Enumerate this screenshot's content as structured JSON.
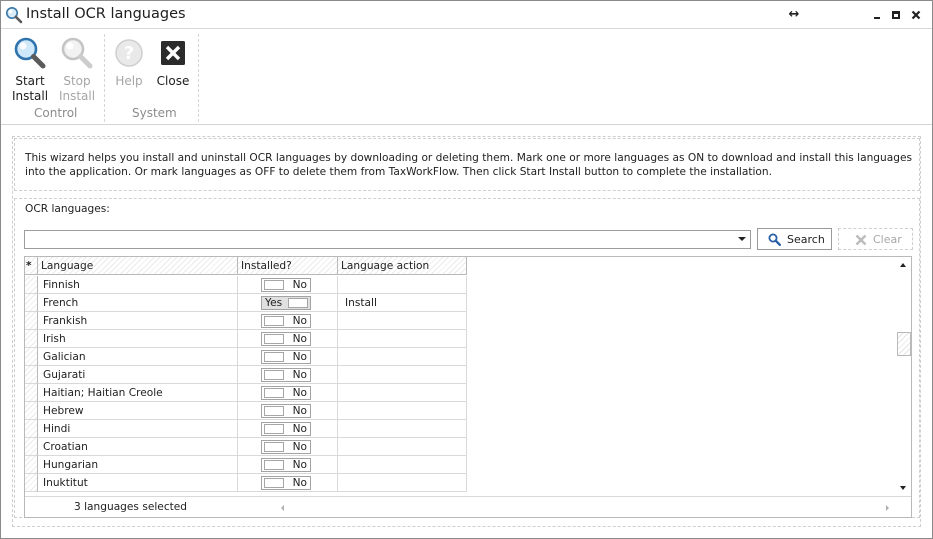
{
  "window": {
    "title": "Install OCR languages"
  },
  "ribbon": {
    "groups": [
      {
        "label": "Control",
        "buttons": [
          {
            "line1": "Start",
            "line2": "Install",
            "icon": "magnifier-icon",
            "enabled": true
          },
          {
            "line1": "Stop",
            "line2": "Install",
            "icon": "magnifier-gray-icon",
            "enabled": false
          }
        ]
      },
      {
        "label": "System",
        "buttons": [
          {
            "line1": "Help",
            "line2": "",
            "icon": "help-icon",
            "enabled": false
          },
          {
            "line1": "Close",
            "line2": "",
            "icon": "close-icon",
            "enabled": true
          }
        ]
      }
    ]
  },
  "description": "This wizard helps you install and uninstall OCR languages by downloading or deleting them. Mark one or more languages as ON to download and install this languages into the application. Or mark languages as OFF to delete them from TaxWorkFlow. Then click Start Install button to complete the installation.",
  "ocr": {
    "group_label": "OCR languages:",
    "search_value": "",
    "search_label": "Search",
    "clear_label": "Clear"
  },
  "grid": {
    "columns": {
      "marker": "*",
      "language": "Language",
      "installed": "Installed?",
      "action": "Language action"
    },
    "rows": [
      {
        "language": "Finnish",
        "installed": "No",
        "on": false,
        "action": ""
      },
      {
        "language": "French",
        "installed": "Yes",
        "on": true,
        "action": "Install"
      },
      {
        "language": "Frankish",
        "installed": "No",
        "on": false,
        "action": ""
      },
      {
        "language": "Irish",
        "installed": "No",
        "on": false,
        "action": ""
      },
      {
        "language": "Galician",
        "installed": "No",
        "on": false,
        "action": ""
      },
      {
        "language": "Gujarati",
        "installed": "No",
        "on": false,
        "action": ""
      },
      {
        "language": "Haitian; Haitian Creole",
        "installed": "No",
        "on": false,
        "action": ""
      },
      {
        "language": "Hebrew",
        "installed": "No",
        "on": false,
        "action": ""
      },
      {
        "language": "Hindi",
        "installed": "No",
        "on": false,
        "action": ""
      },
      {
        "language": "Croatian",
        "installed": "No",
        "on": false,
        "action": ""
      },
      {
        "language": "Hungarian",
        "installed": "No",
        "on": false,
        "action": ""
      },
      {
        "language": "Inuktitut",
        "installed": "No",
        "on": false,
        "action": ""
      }
    ],
    "footer": "3 languages selected"
  }
}
